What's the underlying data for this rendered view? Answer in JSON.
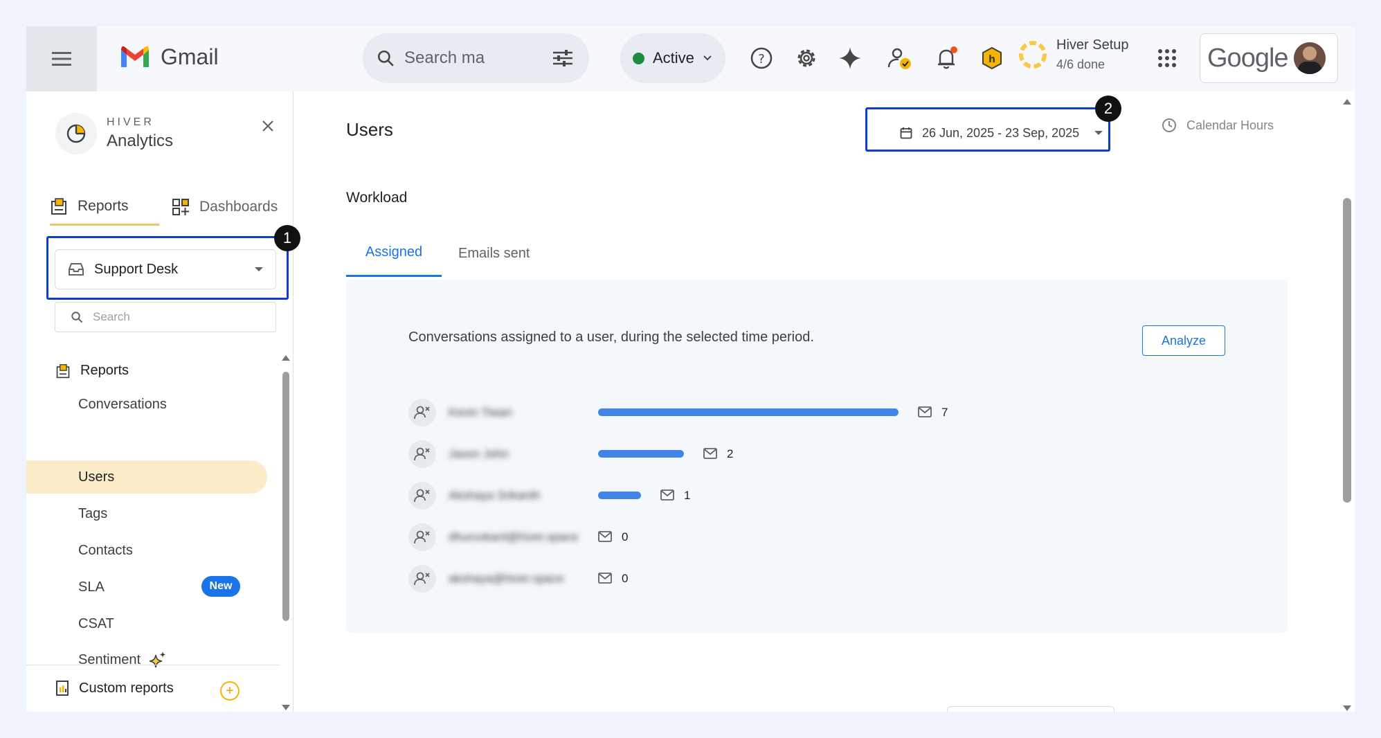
{
  "header": {
    "app_name": "Gmail",
    "search_placeholder": "Search ma",
    "status_label": "Active",
    "setup_title": "Hiver Setup",
    "setup_progress": "4/6 done",
    "account_brand": "Google"
  },
  "sidebar": {
    "brand_small": "HIVER",
    "brand_name": "Analytics",
    "close_icon": "close-icon",
    "tabs": [
      {
        "label": "Reports",
        "icon": "report-icon"
      },
      {
        "label": "Dashboards",
        "icon": "dashboard-icon"
      }
    ],
    "workspace": "Support Desk",
    "search_placeholder": "Search",
    "section_title": "Reports",
    "items": [
      {
        "label": "Conversations"
      },
      {
        "label": "Users"
      },
      {
        "label": "Tags"
      },
      {
        "label": "Contacts"
      },
      {
        "label": "SLA",
        "badge": "New"
      },
      {
        "label": "CSAT"
      },
      {
        "label": "Sentiment"
      }
    ],
    "custom_reports": "Custom reports",
    "callout_1": "1"
  },
  "main": {
    "title": "Users",
    "date_range": "26 Jun, 2025 - 23 Sep, 2025",
    "calendar_hours": "Calendar Hours",
    "callout_2": "2",
    "section": "Workload",
    "tabs": [
      {
        "label": "Assigned"
      },
      {
        "label": "Emails sent"
      }
    ],
    "description": "Conversations assigned to a user, during the selected time period.",
    "analyze_label": "Analyze",
    "users": [
      {
        "name": "Kevin Tiwari",
        "count": "7",
        "value": 7
      },
      {
        "name": "Jason John",
        "count": "2",
        "value": 2
      },
      {
        "name": "Akshaya Srikanth",
        "count": "1",
        "value": 1
      },
      {
        "name": "dhuruvkant@hiver.space",
        "count": "0",
        "value": 0
      },
      {
        "name": "akshaya@hiver.space",
        "count": "0",
        "value": 0
      }
    ]
  },
  "colors": {
    "accent": "#1a73e8",
    "highlight_box": "#0b3fd1",
    "active_item_bg": "#fdecc8",
    "bar": "#4284e5",
    "status_dot": "#1e8e3e"
  }
}
